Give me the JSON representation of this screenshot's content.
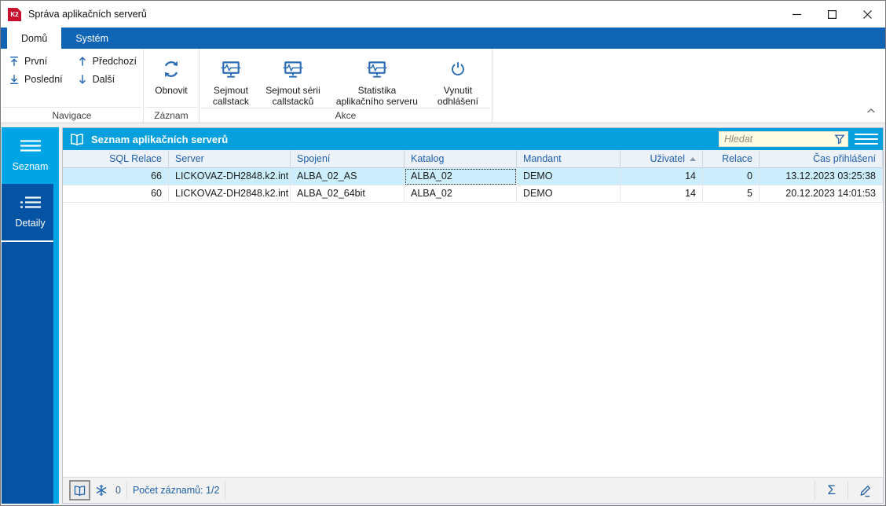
{
  "window": {
    "title": "Správa aplikačních serverů",
    "logo_text": "K2"
  },
  "tabs": [
    {
      "label": "Domů",
      "active": true
    },
    {
      "label": "Systém",
      "active": false
    }
  ],
  "ribbon": {
    "groups": {
      "navigace": {
        "label": "Navigace",
        "first": "První",
        "last": "Poslední",
        "previous": "Předchozí",
        "next": "Další"
      },
      "zaznam": {
        "label": "Záznam",
        "refresh": "Obnovit"
      },
      "akce": {
        "label": "Akce",
        "snap_callstack": "Sejmout\ncallstack",
        "snap_callstack_series": "Sejmout sérii\ncallstacků",
        "server_statistics": "Statistika\naplikačního serveru",
        "force_logout": "Vynutit\nodhlášení"
      }
    }
  },
  "sidebar": {
    "items": [
      {
        "label": "Seznam",
        "active": true
      },
      {
        "label": "Detaily",
        "active": false
      }
    ]
  },
  "panel": {
    "title": "Seznam aplikačních serverů",
    "search_placeholder": "Hledat"
  },
  "table": {
    "columns": [
      {
        "label": "SQL Relace",
        "align": "right"
      },
      {
        "label": "Server",
        "align": "left"
      },
      {
        "label": "Spojení",
        "align": "left"
      },
      {
        "label": "Katalog",
        "align": "left"
      },
      {
        "label": "Mandant",
        "align": "left"
      },
      {
        "label": "Uživatel",
        "align": "right",
        "sorted": "asc"
      },
      {
        "label": "Relace",
        "align": "right"
      },
      {
        "label": "Čas přihlášení",
        "align": "right"
      }
    ],
    "rows": [
      {
        "selected": true,
        "focused_cell": 3,
        "cells": [
          "66",
          "LICKOVAZ-DH2848.k2.int",
          "ALBA_02_AS",
          "ALBA_02",
          "DEMO",
          "14",
          "0",
          "13.12.2023 03:25:38"
        ]
      },
      {
        "selected": false,
        "cells": [
          "60",
          "LICKOVAZ-DH2848.k2.int",
          "ALBA_02_64bit",
          "ALBA_02",
          "DEMO",
          "14",
          "5",
          "20.12.2023 14:01:53"
        ]
      }
    ]
  },
  "statusbar": {
    "asterisk_count": "0",
    "record_count": "Počet záznamů: 1/2",
    "sigma": "Σ"
  },
  "colors": {
    "tab_bar_blue": "#0f64b4",
    "sidebar_blue": "#0553a4",
    "accent_cyan": "#00a5e6",
    "ribbon_icon_blue": "#2a6cb5",
    "table_header_text": "#1e5fa9",
    "selected_row": "#cdeffd",
    "search_background": "#fffce3",
    "logo_red": "#c8102e"
  }
}
